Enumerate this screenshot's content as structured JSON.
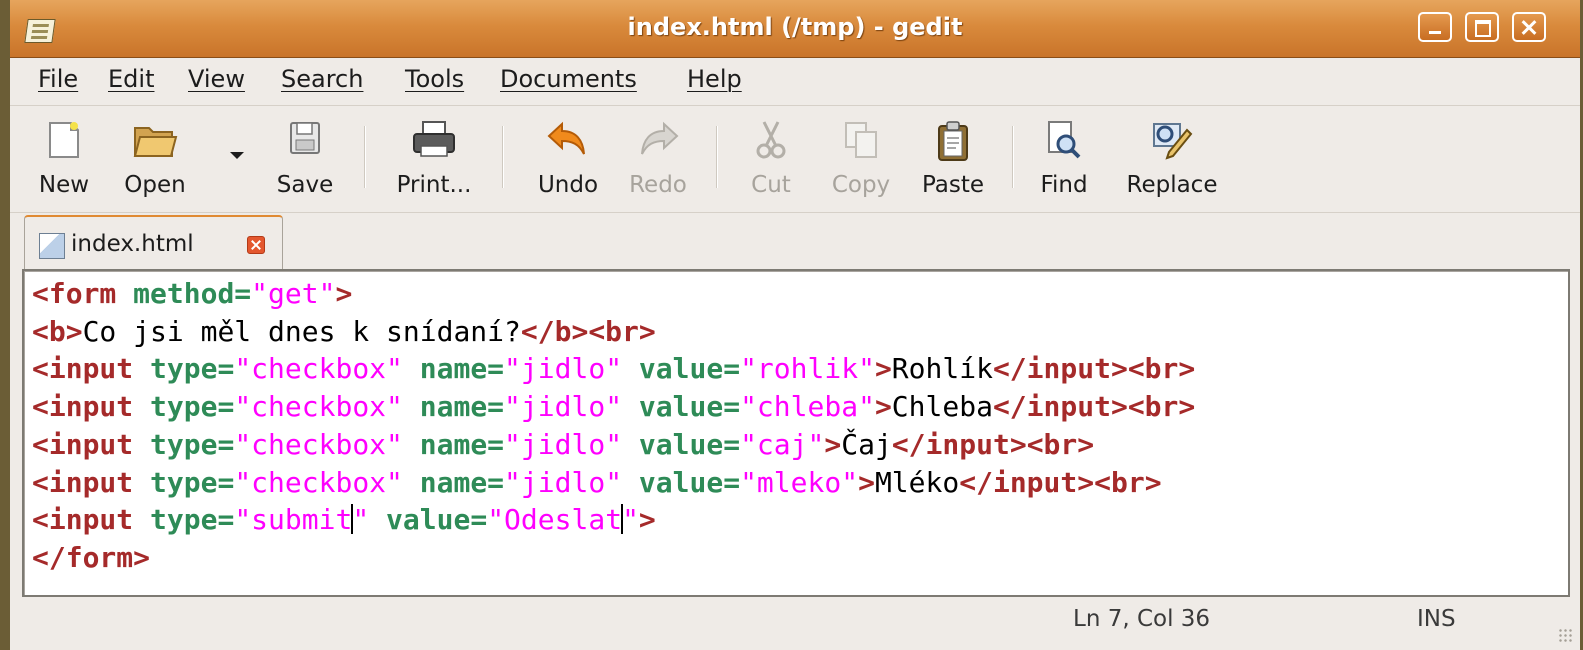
{
  "window": {
    "title": "index.html (/tmp) - gedit",
    "buttons": [
      "minimize",
      "maximize",
      "close"
    ]
  },
  "menu": [
    {
      "label": "File",
      "mnemonic": "F"
    },
    {
      "label": "Edit",
      "mnemonic": "E"
    },
    {
      "label": "View",
      "mnemonic": "V"
    },
    {
      "label": "Search",
      "mnemonic": "S"
    },
    {
      "label": "Tools",
      "mnemonic": "T"
    },
    {
      "label": "Documents",
      "mnemonic": "D"
    },
    {
      "label": "Help",
      "mnemonic": "H"
    }
  ],
  "toolbar": {
    "new": "New",
    "open": "Open",
    "save": "Save",
    "print": "Print...",
    "undo": "Undo",
    "redo": "Redo",
    "cut": "Cut",
    "copy": "Copy",
    "paste": "Paste",
    "find": "Find",
    "replace": "Replace",
    "disabled": [
      "Redo",
      "Cut",
      "Copy"
    ]
  },
  "tab": {
    "label": "index.html"
  },
  "editor": {
    "lines": [
      "<form method=\"get\">",
      "<b>Co jsi měl dnes k snídaní?</b><br>",
      "<input type=\"checkbox\" name=\"jidlo\" value=\"rohlik\">Rohlík</input><br>",
      "<input type=\"checkbox\" name=\"jidlo\" value=\"chleba\">Chleba</input><br>",
      "<input type=\"checkbox\" name=\"jidlo\" value=\"caj\">Čaj</input><br>",
      "<input type=\"checkbox\" name=\"jidlo\" value=\"mleko\">Mléko</input><br>",
      "<input type=\"submit\" value=\"Odeslat\">",
      "</form>"
    ],
    "colors": {
      "tag": "#a52a2a",
      "attribute": "#2e8b57",
      "string": "#ff00ff"
    }
  },
  "status": {
    "position": "Ln 7, Col 36",
    "mode": "INS"
  }
}
